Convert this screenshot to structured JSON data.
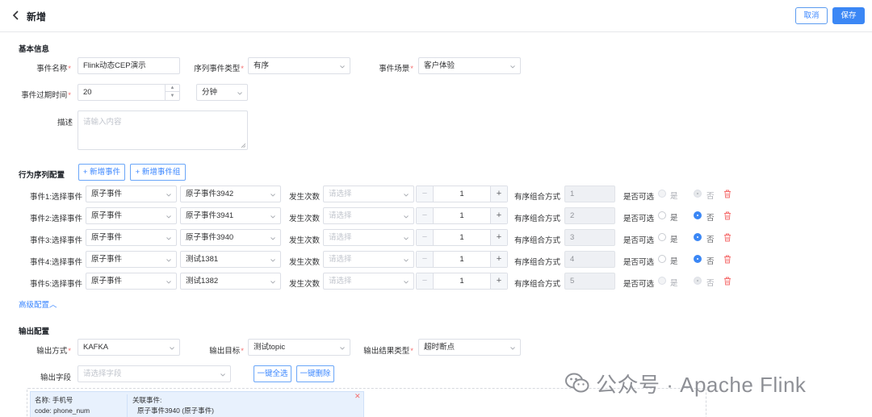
{
  "header": {
    "title": "新增",
    "cancel_label": "取消",
    "save_label": "保存"
  },
  "basic": {
    "section_title": "基本信息",
    "event_name_label": "事件名称",
    "event_name_value": "Flink动态CEP演示",
    "seq_type_label": "序列事件类型",
    "seq_type_value": "有序",
    "scene_label": "事件场景",
    "scene_value": "客户体验",
    "expire_label": "事件过期时间",
    "expire_value": "20",
    "expire_unit": "分钟",
    "desc_label": "描述",
    "desc_placeholder": "请输入内容"
  },
  "behavior": {
    "section_title": "行为序列配置",
    "add_event_label": "+ 新增事件",
    "add_group_label": "+ 新增事件组",
    "select_label_suffix": "选择事件",
    "occur_label": "发生次数",
    "occur_placeholder": "请选择",
    "combo_label": "有序组合方式",
    "optional_label": "是否可选",
    "yes_label": "是",
    "no_label": "否",
    "rows": [
      {
        "label": "事件1:",
        "type": "原子事件",
        "event": "原子事件3942",
        "count": "1",
        "combo": "1",
        "optional_no": true,
        "disabled": true
      },
      {
        "label": "事件2:",
        "type": "原子事件",
        "event": "原子事件3941",
        "count": "1",
        "combo": "2",
        "optional_no": true,
        "disabled": false
      },
      {
        "label": "事件3:",
        "type": "原子事件",
        "event": "原子事件3940",
        "count": "1",
        "combo": "3",
        "optional_no": true,
        "disabled": false
      },
      {
        "label": "事件4:",
        "type": "原子事件",
        "event": "测试1381",
        "count": "1",
        "combo": "4",
        "optional_no": true,
        "disabled": false
      },
      {
        "label": "事件5:",
        "type": "原子事件",
        "event": "测试1382",
        "count": "1",
        "combo": "5",
        "optional_no": true,
        "disabled": true
      }
    ],
    "advanced_link": "高级配置",
    "colors": {
      "primary": "#3b87f5",
      "danger": "#f56c6c"
    }
  },
  "output": {
    "section_title": "输出配置",
    "method_label": "输出方式",
    "method_value": "KAFKA",
    "target_label": "输出目标",
    "target_value": "测试topic",
    "result_type_label": "输出结果类型",
    "result_type_value": "超时断点",
    "field_label": "输出字段",
    "field_placeholder": "请选择字段",
    "select_all_label": "一键全选",
    "delete_all_label": "一键删除",
    "card": {
      "name_line": "名称: 手机号",
      "code_line": "code: phone_num",
      "related_title": "关联事件:",
      "related_value": "原子事件3940 (原子事件)"
    }
  },
  "watermark": {
    "text": "公众号 · Apache Flink",
    "icon": "wechat-icon"
  }
}
